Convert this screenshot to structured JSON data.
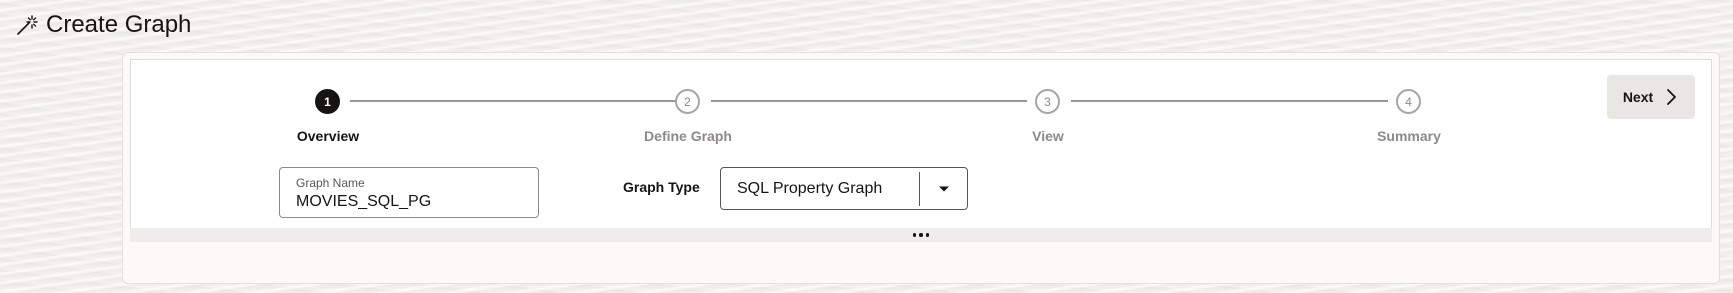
{
  "page": {
    "title": "Create Graph",
    "title_icon": "magic-wand-icon"
  },
  "stepper": {
    "steps": [
      {
        "number": "1",
        "label": "Overview",
        "state": "active"
      },
      {
        "number": "2",
        "label": "Define Graph",
        "state": "inactive"
      },
      {
        "number": "3",
        "label": "View",
        "state": "inactive"
      },
      {
        "number": "4",
        "label": "Summary",
        "state": "inactive"
      }
    ]
  },
  "actions": {
    "next_label": "Next",
    "next_icon": "chevron-right-icon"
  },
  "form": {
    "graph_name": {
      "label": "Graph Name",
      "value": "MOVIES_SQL_PG"
    },
    "graph_type": {
      "label": "Graph Type",
      "selected": "SQL Property Graph",
      "icon": "caret-down-icon"
    }
  },
  "collapse_bar": {
    "icon": "more-horizontal-icon"
  },
  "colors": {
    "active_step": "#161513",
    "inactive_step": "#8d8a86",
    "connector": "#9a9794",
    "next_button_bg": "#e9e7e4"
  }
}
